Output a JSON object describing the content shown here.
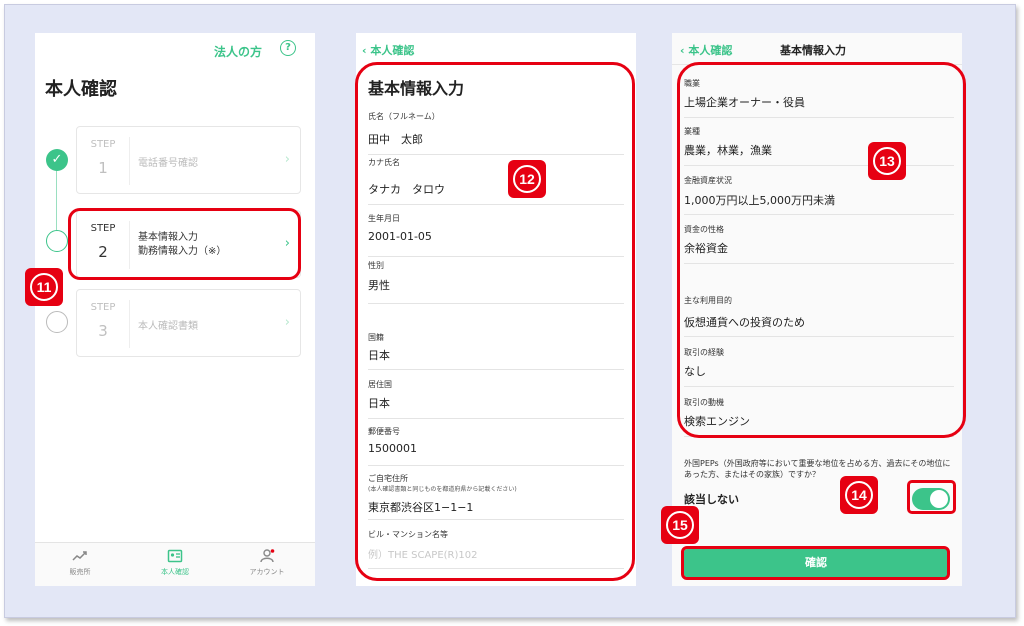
{
  "screen1": {
    "corp_link": "法人の方",
    "help_icon": "?",
    "title": "本人確認",
    "steps": [
      {
        "step_label": "STEP",
        "num": "1",
        "line1": "電話番号確認",
        "line2": ""
      },
      {
        "step_label": "STEP",
        "num": "2",
        "line1": "基本情報入力",
        "line2": "勤務情報入力（※）"
      },
      {
        "step_label": "STEP",
        "num": "3",
        "line1": "本人確認書類",
        "line2": ""
      }
    ],
    "tabs": [
      {
        "icon": "chart-icon",
        "label": "販売所"
      },
      {
        "icon": "id-card-icon",
        "label": "本人確認"
      },
      {
        "icon": "account-icon",
        "label": "アカウント"
      }
    ]
  },
  "screen2": {
    "back": "本人確認",
    "title": "基本情報入力",
    "fields": [
      {
        "label": "氏名（フルネーム）",
        "value": "田中　太郎"
      },
      {
        "label": "カナ氏名",
        "value": "タナカ　タロウ"
      },
      {
        "label": "生年月日",
        "value": "2001-01-05"
      },
      {
        "label": "性別",
        "value": "男性"
      },
      {
        "label": "国籍",
        "value": "日本"
      },
      {
        "label": "居住国",
        "value": "日本"
      },
      {
        "label": "郵便番号",
        "value": "1500001"
      },
      {
        "label": "ご自宅住所",
        "sublabel": "(本人確認書類と同じものを都道府県から記載ください)",
        "value": "東京都渋谷区1−1−1"
      },
      {
        "label": "ビル・マンション名等",
        "placeholder": "例）THE SCAPE(R)102"
      }
    ]
  },
  "screen3": {
    "back": "本人確認",
    "title": "基本情報入力",
    "fields": [
      {
        "label": "職業",
        "value": "上場企業オーナー・役員"
      },
      {
        "label": "業種",
        "value": "農業，林業，漁業"
      },
      {
        "label": "金融資産状況",
        "value": "1,000万円以上5,000万円未満"
      },
      {
        "label": "資金の性格",
        "value": "余裕資金"
      },
      {
        "label": "主な利用目的",
        "value": "仮想通貨への投資のため"
      },
      {
        "label": "取引の経験",
        "value": "なし"
      },
      {
        "label": "取引の動機",
        "value": "検索エンジン"
      }
    ],
    "peps_label": "外国PEPs（外国政府等において重要な地位を占める方、過去にその地位にあった方、またはその家族）ですか？",
    "peps_value": "該当しない",
    "peps_toggle_on": true,
    "confirm_label": "確認"
  },
  "annotations": {
    "b11": "11",
    "b12": "12",
    "b13": "13",
    "b14": "14",
    "b15": "15",
    "color": "#e60012"
  },
  "accent_color": "#3cc48a"
}
